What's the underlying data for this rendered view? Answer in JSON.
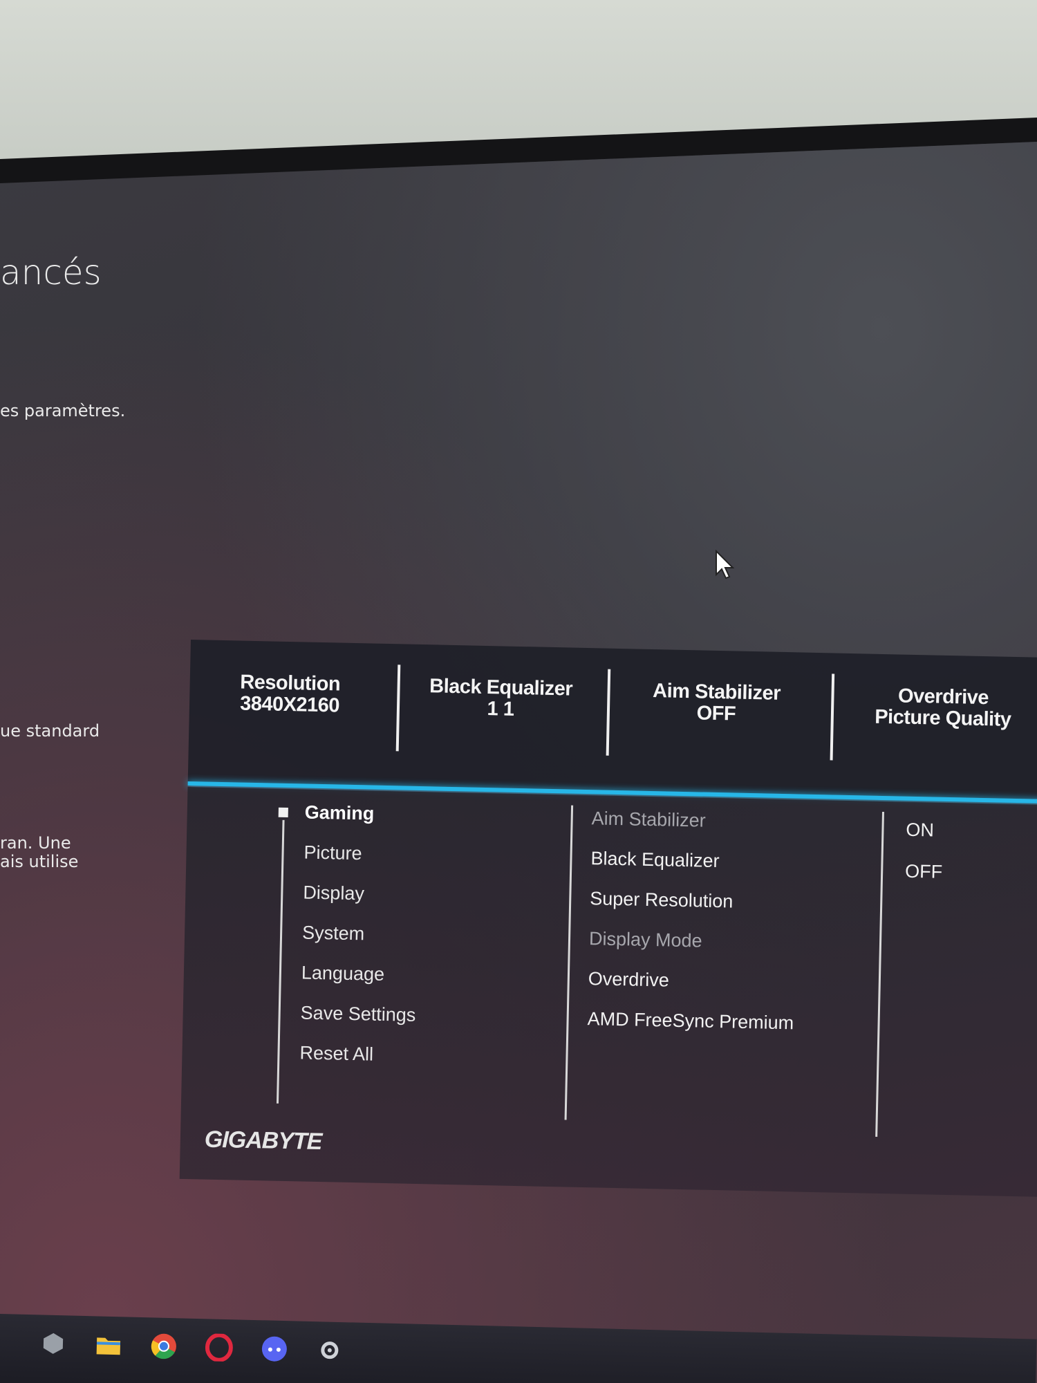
{
  "background_window": {
    "title_fragment": "ancés",
    "lines": [
      "es paramètres.",
      "ue standard",
      "ran. Une",
      "ais utilise"
    ]
  },
  "osd": {
    "status_bar": [
      {
        "label": "Resolution",
        "value": "3840X2160"
      },
      {
        "label": "Black Equalizer",
        "value": "1 1"
      },
      {
        "label": "Aim Stabilizer",
        "value": "OFF"
      },
      {
        "label": "Overdrive",
        "value": "Picture Quality"
      }
    ],
    "menu": [
      "Gaming",
      "Picture",
      "Display",
      "System",
      "Language",
      "Save Settings",
      "Reset All"
    ],
    "active_menu": "Gaming",
    "submenu": [
      "Aim Stabilizer",
      "Black Equalizer",
      "Super Resolution",
      "Display Mode",
      "Overdrive",
      "AMD FreeSync Premium"
    ],
    "options": [
      "ON",
      "OFF"
    ],
    "brand": "GIGABYTE",
    "accent_color": "#27b7e8"
  },
  "taskbar": {
    "icons": [
      "widget-icon",
      "folder-icon",
      "chrome-icon",
      "opera-icon",
      "discord-icon",
      "settings-icon"
    ]
  }
}
